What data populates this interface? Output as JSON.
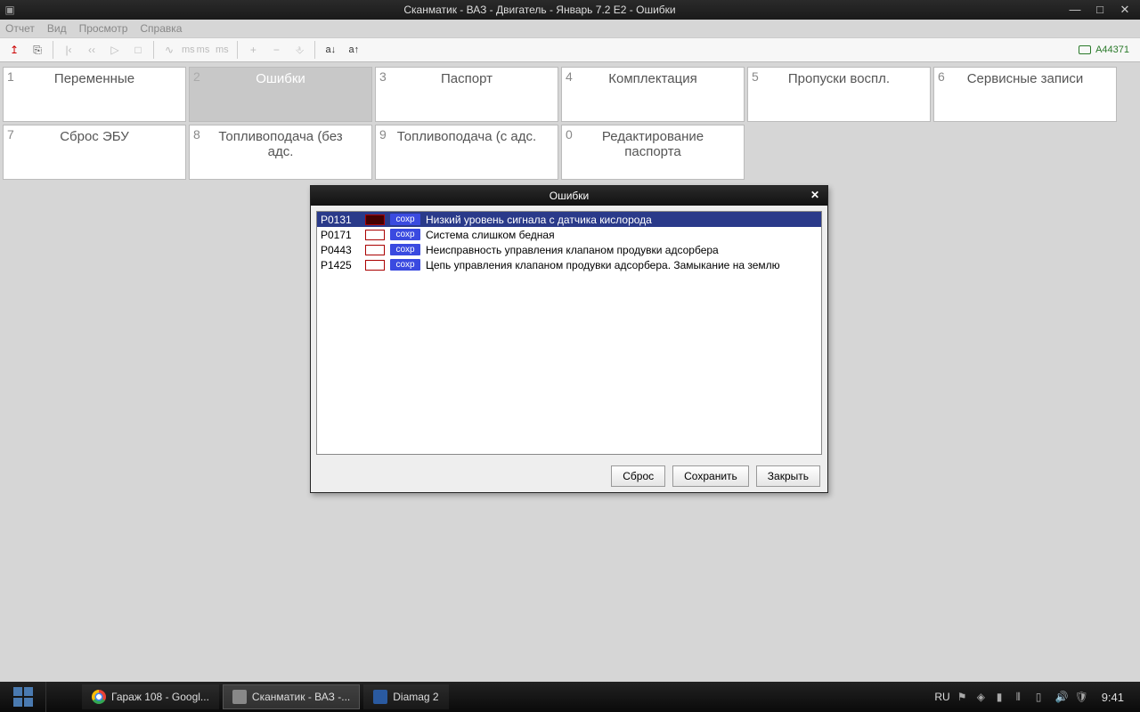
{
  "window": {
    "title": "Сканматик - ВАЗ - Двигатель - Январь 7.2 E2 - Ошибки"
  },
  "menu": [
    "Отчет",
    "Вид",
    "Просмотр",
    "Справка"
  ],
  "toolbar": {
    "counter": "A44371",
    "sort_asc": "a↓",
    "sort_desc": "a↑",
    "ms1": "ms",
    "ms2": "ms",
    "ms3": "ms"
  },
  "tabs": [
    {
      "num": "1",
      "label": "Переменные"
    },
    {
      "num": "2",
      "label": "Ошибки",
      "active": true
    },
    {
      "num": "3",
      "label": "Паспорт"
    },
    {
      "num": "4",
      "label": "Комплектация"
    },
    {
      "num": "5",
      "label": "Пропуски воспл."
    },
    {
      "num": "6",
      "label": "Сервисные записи"
    },
    {
      "num": "7",
      "label": "Сброс ЭБУ"
    },
    {
      "num": "8",
      "label": "Топливоподача (без адс."
    },
    {
      "num": "9",
      "label": "Топливоподача (с адс."
    },
    {
      "num": "0",
      "label": "Редактирование паспорта"
    }
  ],
  "modal": {
    "title": "Ошибки",
    "errors": [
      {
        "code": "P0131",
        "tag": "сохр",
        "desc": "Низкий уровень сигнала с датчика кислорода",
        "selected": true
      },
      {
        "code": "P0171",
        "tag": "сохр",
        "desc": "Система слишком бедная"
      },
      {
        "code": "P0443",
        "tag": "сохр",
        "desc": "Неисправность управления клапаном продувки адсорбера"
      },
      {
        "code": "P1425",
        "tag": "сохр",
        "desc": "Цепь управления клапаном продувки адсорбера. Замыкание на землю"
      }
    ],
    "buttons": {
      "reset": "Сброс",
      "save": "Сохранить",
      "close": "Закрыть"
    }
  },
  "taskbar": {
    "items": [
      {
        "label": "Гараж 108 - Googl...",
        "icon": "chrome"
      },
      {
        "label": "Сканматик - ВАЗ -...",
        "icon": "grey",
        "active": true
      },
      {
        "label": "Diamag 2",
        "icon": "blue"
      }
    ],
    "lang": "RU",
    "clock": "9:41"
  }
}
